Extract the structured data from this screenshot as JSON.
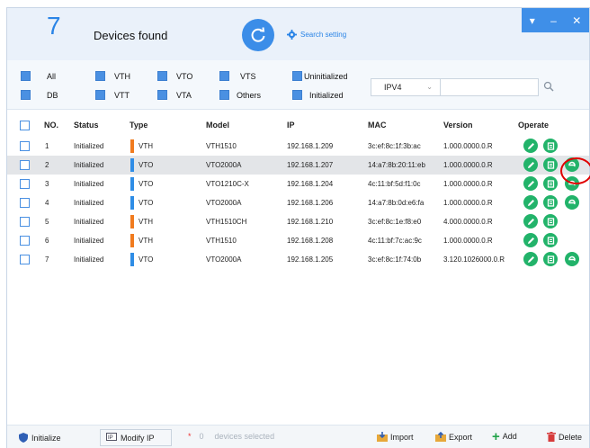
{
  "header": {
    "device_count": "7",
    "devices_found_label": "Devices found",
    "search_setting_label": "Search setting",
    "window_buttons": [
      "▾",
      "–",
      "✕"
    ]
  },
  "filters": {
    "row1": [
      "All",
      "VTH",
      "VTO",
      "VTS",
      "Uninitialized"
    ],
    "row2": [
      "DB",
      "VTT",
      "VTA",
      "Others",
      "Initialized"
    ],
    "ip_version": "IPV4",
    "search_value": ""
  },
  "table": {
    "headers": {
      "no": "NO.",
      "status": "Status",
      "type": "Type",
      "model": "Model",
      "ip": "IP",
      "mac": "MAC",
      "version": "Version",
      "operate": "Operate"
    },
    "rows": [
      {
        "no": "1",
        "status": "Initialized",
        "type": "VTH",
        "model": "VTH1510",
        "ip": "192.168.1.209",
        "mac": "3c:ef:8c:1f:3b:ac",
        "version": "1.000.0000.0.R",
        "web": false
      },
      {
        "no": "2",
        "status": "Initialized",
        "type": "VTO",
        "model": "VTO2000A",
        "ip": "192.168.1.207",
        "mac": "14:a7:8b:20:11:eb",
        "version": "1.000.0000.0.R",
        "web": true
      },
      {
        "no": "3",
        "status": "Initialized",
        "type": "VTO",
        "model": "VTO1210C-X",
        "ip": "192.168.1.204",
        "mac": "4c:11:bf:5d:f1:0c",
        "version": "1.000.0000.0.R",
        "web": true
      },
      {
        "no": "4",
        "status": "Initialized",
        "type": "VTO",
        "model": "VTO2000A",
        "ip": "192.168.1.206",
        "mac": "14:a7:8b:0d:e6:fa",
        "version": "1.000.0000.0.R",
        "web": true
      },
      {
        "no": "5",
        "status": "Initialized",
        "type": "VTH",
        "model": "VTH1510CH",
        "ip": "192.168.1.210",
        "mac": "3c:ef:8c:1e:f8:e0",
        "version": "4.000.0000.0.R",
        "web": false
      },
      {
        "no": "6",
        "status": "Initialized",
        "type": "VTH",
        "model": "VTH1510",
        "ip": "192.168.1.208",
        "mac": "4c:11:bf:7c:ac:9c",
        "version": "1.000.0000.0.R",
        "web": false
      },
      {
        "no": "7",
        "status": "Initialized",
        "type": "VTO",
        "model": "VTO2000A",
        "ip": "192.168.1.205",
        "mac": "3c:ef:8c:1f:74:0b",
        "version": "3.120.1026000.0.R",
        "web": true
      }
    ]
  },
  "footer": {
    "initialize_label": "Initialize",
    "modify_ip_label": "Modify IP",
    "selected_star": "*",
    "selected_count": "0",
    "selected_text": "devices selected",
    "import_label": "Import",
    "export_label": "Export",
    "add_label": "Add",
    "delete_label": "Delete"
  },
  "colors": {
    "accent": "#3b8de8",
    "vth": "#f07b1f",
    "vto": "#2f8de6",
    "operate": "#22b36a",
    "highlight": "#e00000"
  }
}
